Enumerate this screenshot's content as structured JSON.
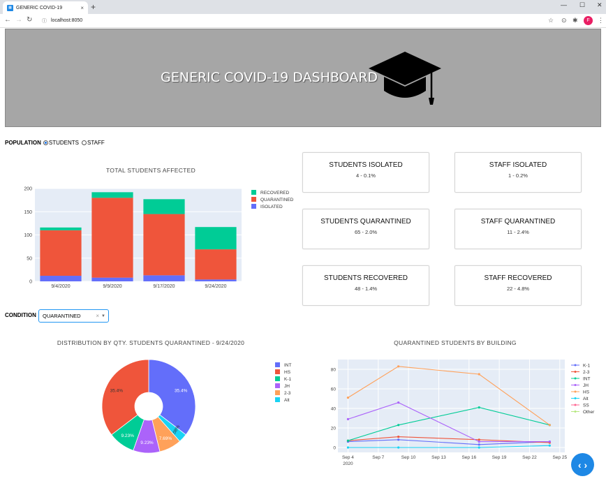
{
  "browser": {
    "tab_title": "GENERIC COVID-19",
    "tab_close": "×",
    "new_tab": "+",
    "url": "localhost:8050",
    "profile_initial": "F",
    "win_min": "—",
    "win_max": "☐",
    "win_close": "✕"
  },
  "header": {
    "title": "GENERIC COVID-19 DASHBOARD"
  },
  "population": {
    "label": "POPULATION",
    "options": [
      "STUDENTS",
      "STAFF"
    ],
    "selected": "STUDENTS"
  },
  "cards": [
    {
      "title": "STUDENTS ISOLATED",
      "value": "4 - 0.1%"
    },
    {
      "title": "STAFF ISOLATED",
      "value": "1 - 0.2%"
    },
    {
      "title": "STUDENTS QUARANTINED",
      "value": "65 - 2.0%"
    },
    {
      "title": "STAFF QUARANTINED",
      "value": "11 - 2.4%"
    },
    {
      "title": "STUDENTS RECOVERED",
      "value": "48 - 1.4%"
    },
    {
      "title": "STAFF RECOVERED",
      "value": "22 - 4.8%"
    }
  ],
  "condition": {
    "label": "CONDITION",
    "value": "QUARANTINED",
    "clear": "×",
    "arrow": "▼"
  },
  "chart_data": [
    {
      "type": "bar",
      "stacked": true,
      "title": "TOTAL STUDENTS AFFECTED",
      "categories": [
        "9/4/2020",
        "9/9/2020",
        "9/17/2020",
        "9/24/2020"
      ],
      "ylim": [
        0,
        200
      ],
      "yticks": [
        0,
        50,
        100,
        150,
        200
      ],
      "legend_position": "right",
      "series": [
        {
          "name": "ISOLATED",
          "color": "#636efa",
          "values": [
            12,
            8,
            13,
            4
          ]
        },
        {
          "name": "QUARANTINED",
          "color": "#ef553b",
          "values": [
            98,
            172,
            132,
            65
          ]
        },
        {
          "name": "RECOVERED",
          "color": "#00cc96",
          "values": [
            6,
            12,
            32,
            48
          ]
        }
      ]
    },
    {
      "type": "pie",
      "donut": true,
      "title": "DISTRIBUTION BY QTY. STUDENTS QUARANTINED - 9/24/2020",
      "legend_position": "right",
      "slices": [
        {
          "label": "INT",
          "value": 35.4,
          "text": "35.4%",
          "color": "#636efa"
        },
        {
          "label": "Alt",
          "value": 3.08,
          "text": "3.08%",
          "color": "#19d3f3"
        },
        {
          "label": "2-3",
          "value": 7.69,
          "text": "7.69%",
          "color": "#ffa15a"
        },
        {
          "label": "JH",
          "value": 9.23,
          "text": "9.23%",
          "color": "#ab63fa"
        },
        {
          "label": "K-1",
          "value": 9.23,
          "text": "9.23%",
          "color": "#00cc96"
        },
        {
          "label": "HS",
          "value": 35.4,
          "text": "35.4%",
          "color": "#ef553b"
        }
      ],
      "legend_order": [
        "INT",
        "HS",
        "K-1",
        "JH",
        "2-3",
        "Alt"
      ]
    },
    {
      "type": "line",
      "title": "QUARANTINED STUDENTS BY BUILDING",
      "x_ticks": [
        "Sep 4",
        "Sep 7",
        "Sep 10",
        "Sep 13",
        "Sep 16",
        "Sep 19",
        "Sep 22",
        "Sep 25"
      ],
      "x_year_label": "2020",
      "ylim": [
        -5,
        90
      ],
      "yticks": [
        0,
        20,
        40,
        60,
        80
      ],
      "legend_position": "right",
      "x": [
        "2020-09-04",
        "2020-09-09",
        "2020-09-17",
        "2020-09-24"
      ],
      "series": [
        {
          "name": "K-1",
          "color": "#636efa",
          "values": [
            6,
            8,
            3,
            6
          ]
        },
        {
          "name": "2-3",
          "color": "#ef553b",
          "values": [
            7,
            11,
            8,
            5
          ]
        },
        {
          "name": "INT",
          "color": "#00cc96",
          "values": [
            7,
            23,
            41,
            23
          ]
        },
        {
          "name": "JH",
          "color": "#ab63fa",
          "values": [
            29,
            46,
            6,
            6
          ]
        },
        {
          "name": "HS",
          "color": "#ffa15a",
          "values": [
            51,
            83,
            75,
            23
          ]
        },
        {
          "name": "Alt",
          "color": "#19d3f3",
          "values": [
            0,
            0,
            0,
            2
          ]
        },
        {
          "name": "SS",
          "color": "#ff6692",
          "values": []
        },
        {
          "name": "Other",
          "color": "#b6e880",
          "values": []
        }
      ]
    }
  ]
}
